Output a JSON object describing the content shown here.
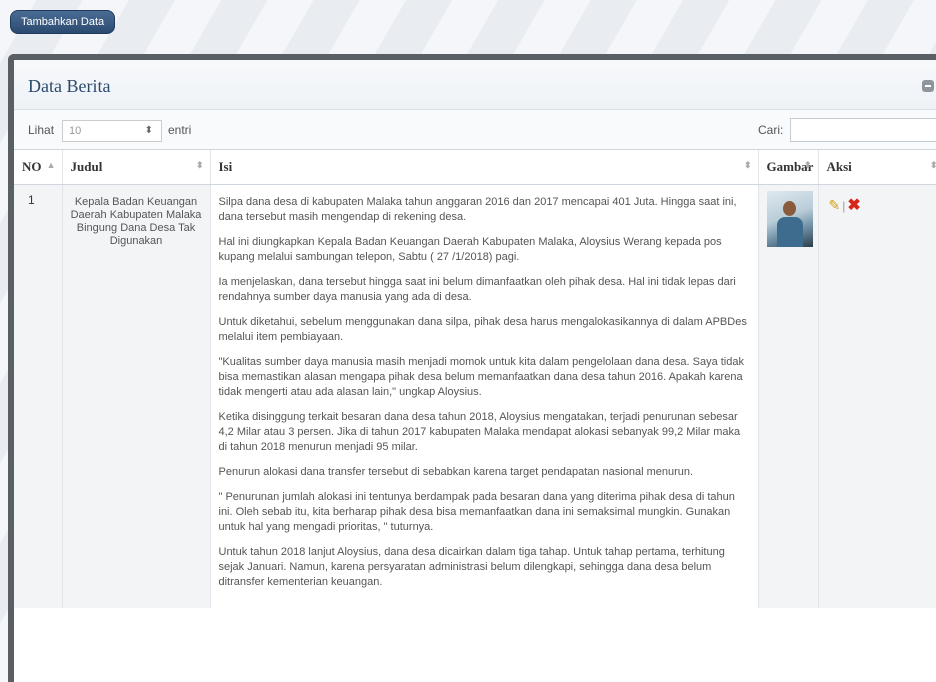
{
  "toolbar": {
    "add_label": "Tambahkan Data"
  },
  "panel": {
    "title": "Data Berita"
  },
  "controls": {
    "show_label": "Lihat",
    "page_size": "10",
    "entries_label": "entri",
    "search_label": "Cari:",
    "search_value": ""
  },
  "table": {
    "headers": [
      "NO",
      "Judul",
      "Isi",
      "Gambar",
      "Aksi"
    ],
    "rows": [
      {
        "no": "1",
        "judul": "Kepala Badan Keuangan Daerah Kabupaten Malaka Bingung Dana Desa Tak Digunakan",
        "isi": [
          "Silpa dana desa di kabupaten Malaka tahun anggaran 2016 dan 2017 mencapai 401 Juta. Hingga saat ini, dana tersebut masih mengendap di rekening desa.",
          "Hal ini diungkapkan Kepala Badan Keuangan Daerah Kabupaten Malaka, Aloysius Werang kepada pos kupang melalui sambungan telepon, Sabtu ( 27 /1/2018) pagi.",
          "Ia menjelaskan, dana tersebut hingga saat ini belum dimanfaatkan oleh pihak desa. Hal ini tidak lepas dari rendahnya sumber daya manusia yang ada di desa.",
          "Untuk diketahui, sebelum menggunakan dana silpa, pihak desa harus mengalokasikannya di dalam APBDes melalui item pembiayaan.",
          "\"Kualitas sumber daya manusia masih menjadi momok untuk kita dalam pengelolaan dana desa. Saya tidak bisa memastikan alasan mengapa pihak desa belum memanfaatkan dana desa tahun 2016. Apakah karena tidak mengerti atau ada alasan lain,\" ungkap Aloysius.",
          "Ketika disinggung terkait besaran dana desa tahun 2018, Aloysius mengatakan, terjadi penurunan sebesar 4,2 Milar atau 3 persen. Jika di tahun 2017 kabupaten Malaka mendapat alokasi sebanyak 99,2 Milar maka di tahun 2018 menurun menjadi 95 milar.",
          "Penurun alokasi dana transfer tersebut di sebabkan karena target pendapatan nasional menurun.",
          "\" Penurunan jumlah alokasi ini tentunya berdampak pada besaran dana yang diterima pihak desa di tahun ini. Oleh sebab itu, kita berharap pihak desa bisa memanfaatkan dana ini semaksimal mungkin. Gunakan untuk hal yang mengadi prioritas, \" tuturnya.",
          "Untuk tahun 2018 lanjut Aloysius, dana desa dicairkan dalam tiga tahap. Untuk tahap pertama, terhitung sejak Januari. Namun, karena persyaratan administrasi belum dilengkapi, sehingga dana desa belum ditransfer kementerian keuangan."
        ]
      }
    ]
  },
  "icons": {
    "edit": "pencil-icon",
    "delete": "delete-x-icon",
    "collapse": "collapse-icon"
  },
  "colors": {
    "accent": "#2c4a70",
    "title": "#2a4a6e",
    "delete": "#d9261c",
    "edit": "#d4a017"
  }
}
